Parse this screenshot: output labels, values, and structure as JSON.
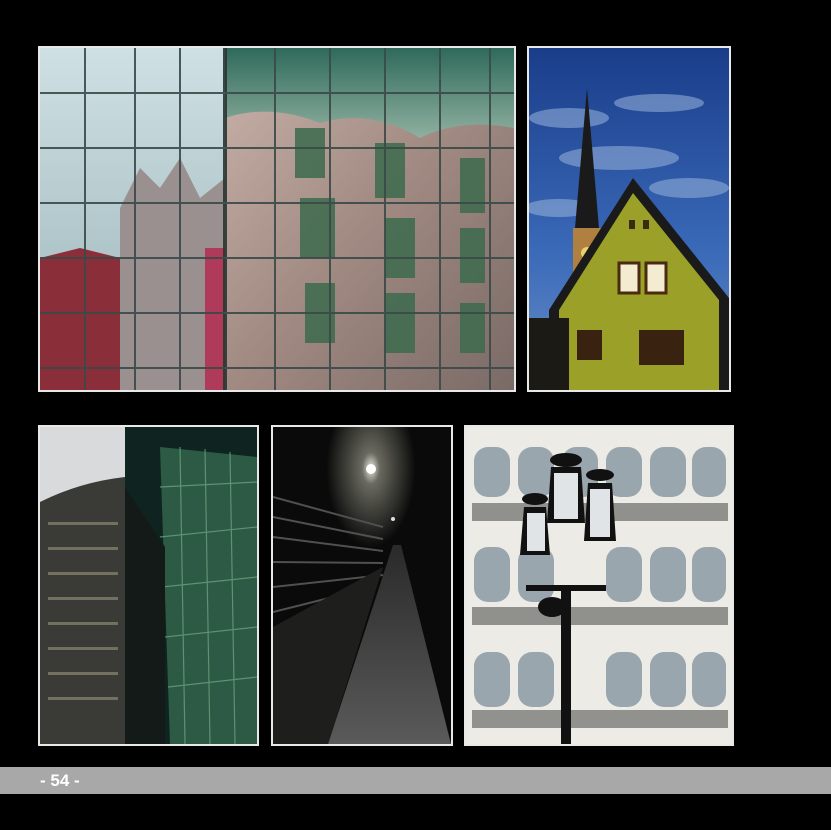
{
  "page": {
    "number_label": "- 54 -"
  },
  "colors": {
    "background": "#000000",
    "footer_bar": "#a8a8a8",
    "frame": "#e8e8e8"
  }
}
